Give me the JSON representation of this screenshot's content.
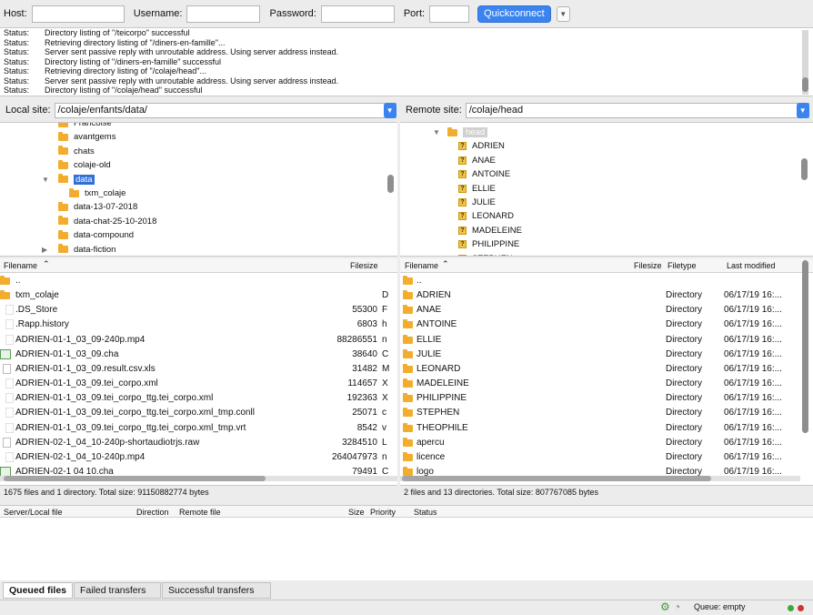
{
  "quickconnect": {
    "host_label": "Host:",
    "username_label": "Username:",
    "password_label": "Password:",
    "port_label": "Port:",
    "host": "",
    "username": "",
    "password": "",
    "port": "",
    "button": "Quickconnect"
  },
  "log": [
    {
      "t": "Status:",
      "m": "Directory listing of \"/teicorpo\" successful"
    },
    {
      "t": "Status:",
      "m": "Retrieving directory listing of \"/diners-en-famille\"..."
    },
    {
      "t": "Status:",
      "m": "Server sent passive reply with unroutable address. Using server address instead."
    },
    {
      "t": "Status:",
      "m": "Directory listing of \"/diners-en-famille\" successful"
    },
    {
      "t": "Status:",
      "m": "Retrieving directory listing of \"/colaje/head\"..."
    },
    {
      "t": "Status:",
      "m": "Server sent passive reply with unroutable address. Using server address instead."
    },
    {
      "t": "Status:",
      "m": "Directory listing of \"/colaje/head\" successful"
    }
  ],
  "local": {
    "label": "Local site:",
    "path": "/colaje/enfants/data/",
    "tree": [
      {
        "name": "Francoise",
        "level": 1
      },
      {
        "name": "avantgems",
        "level": 1
      },
      {
        "name": "chats",
        "level": 1
      },
      {
        "name": "colaje-old",
        "level": 1
      },
      {
        "name": "data",
        "level": 1,
        "expanded": true,
        "selected": true
      },
      {
        "name": "txm_colaje",
        "level": 2
      },
      {
        "name": "data-13-07-2018",
        "level": 1
      },
      {
        "name": "data-chat-25-10-2018",
        "level": 1
      },
      {
        "name": "data-compound",
        "level": 1
      },
      {
        "name": "data-fiction",
        "level": 1,
        "collapsed": true
      }
    ],
    "columns": {
      "name": "Filename",
      "size": "Filesize"
    },
    "files": [
      {
        "name": "..",
        "size": "",
        "icon": "folder",
        "cut": ""
      },
      {
        "name": "txm_colaje",
        "size": "",
        "icon": "folder",
        "cut": "D"
      },
      {
        "name": ".DS_Store",
        "size": "55300",
        "icon": "file",
        "cut": "F"
      },
      {
        "name": ".Rapp.history",
        "size": "6803",
        "icon": "file",
        "cut": "h"
      },
      {
        "name": "ADRIEN-01-1_03_09-240p.mp4",
        "size": "88286551",
        "icon": "file",
        "cut": "n"
      },
      {
        "name": "ADRIEN-01-1_03_09.cha",
        "size": "38640",
        "icon": "excel",
        "cut": "C"
      },
      {
        "name": "ADRIEN-01-1_03_09.result.csv.xls",
        "size": "31482",
        "icon": "doc",
        "cut": "M"
      },
      {
        "name": "ADRIEN-01-1_03_09.tei_corpo.xml",
        "size": "114657",
        "icon": "file",
        "cut": "X"
      },
      {
        "name": "ADRIEN-01-1_03_09.tei_corpo_ttg.tei_corpo.xml",
        "size": "192363",
        "icon": "file",
        "cut": "X"
      },
      {
        "name": "ADRIEN-01-1_03_09.tei_corpo_ttg.tei_corpo.xml_tmp.conll",
        "size": "25071",
        "icon": "file",
        "cut": "c"
      },
      {
        "name": "ADRIEN-01-1_03_09.tei_corpo_ttg.tei_corpo.xml_tmp.vrt",
        "size": "8542",
        "icon": "file",
        "cut": "v"
      },
      {
        "name": "ADRIEN-02-1_04_10-240p-shortaudiotrjs.raw",
        "size": "3284510",
        "icon": "raw",
        "cut": "L"
      },
      {
        "name": "ADRIEN-02-1_04_10-240p.mp4",
        "size": "264047973",
        "icon": "file",
        "cut": "n"
      },
      {
        "name": "ADRIEN-02-1 04 10.cha",
        "size": "79491",
        "icon": "excel",
        "cut": "C"
      }
    ],
    "summary": "1675 files and 1 directory. Total size: 91150882774 bytes"
  },
  "remote": {
    "label": "Remote site:",
    "path": "/colaje/head",
    "tree": [
      "head",
      "ADRIEN",
      "ANAE",
      "ANTOINE",
      "ELLIE",
      "JULIE",
      "LEONARD",
      "MADELEINE",
      "PHILIPPINE",
      "STEPHEN"
    ],
    "columns": {
      "name": "Filename",
      "size": "Filesize",
      "type": "Filetype",
      "modified": "Last modified"
    },
    "files": [
      {
        "name": "..",
        "type": "",
        "modified": ""
      },
      {
        "name": "ADRIEN",
        "type": "Directory",
        "modified": "06/17/19 16:..."
      },
      {
        "name": "ANAE",
        "type": "Directory",
        "modified": "06/17/19 16:..."
      },
      {
        "name": "ANTOINE",
        "type": "Directory",
        "modified": "06/17/19 16:..."
      },
      {
        "name": "ELLIE",
        "type": "Directory",
        "modified": "06/17/19 16:..."
      },
      {
        "name": "JULIE",
        "type": "Directory",
        "modified": "06/17/19 16:..."
      },
      {
        "name": "LEONARD",
        "type": "Directory",
        "modified": "06/17/19 16:..."
      },
      {
        "name": "MADELEINE",
        "type": "Directory",
        "modified": "06/17/19 16:..."
      },
      {
        "name": "PHILIPPINE",
        "type": "Directory",
        "modified": "06/17/19 16:..."
      },
      {
        "name": "STEPHEN",
        "type": "Directory",
        "modified": "06/17/19 16:..."
      },
      {
        "name": "THEOPHILE",
        "type": "Directory",
        "modified": "06/17/19 16:..."
      },
      {
        "name": "apercu",
        "type": "Directory",
        "modified": "06/17/19 16:..."
      },
      {
        "name": "licence",
        "type": "Directory",
        "modified": "06/17/19 16:..."
      },
      {
        "name": "logo",
        "type": "Directory",
        "modified": "06/17/19 16:..."
      }
    ],
    "summary": "2 files and 13 directories. Total size: 807767085 bytes"
  },
  "queue": {
    "columns": [
      "Server/Local file",
      "Direction",
      "Remote file",
      "Size",
      "Priority",
      "Status"
    ]
  },
  "tabs": [
    "Queued files",
    "Failed transfers",
    "Successful transfers"
  ],
  "status": {
    "queue": "Queue: empty"
  },
  "colors": {
    "accent": "#3b84f0",
    "folder": "#f3ad2e",
    "selection": "#2f6fd6"
  }
}
